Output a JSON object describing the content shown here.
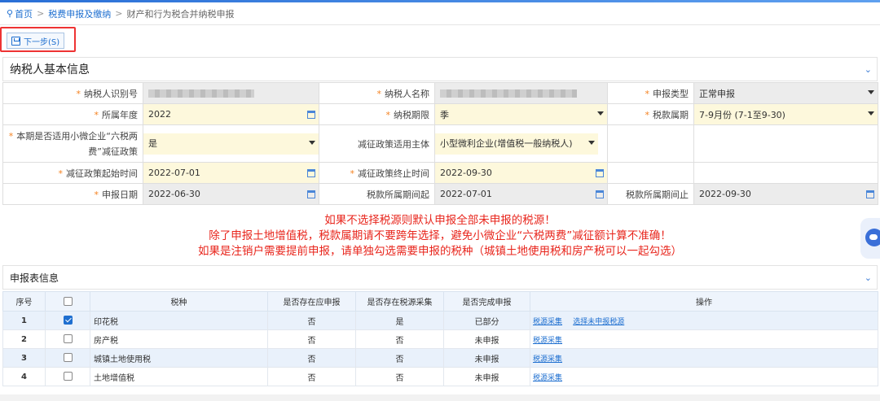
{
  "breadcrumb": {
    "home": "首页",
    "level2": "税费申报及缴纳",
    "current": "财产和行为税合并纳税申报"
  },
  "toolbar": {
    "next_label": "下一步(S)"
  },
  "taxpayer_panel": {
    "title": "纳税人基本信息",
    "fields": {
      "taxpayer_id_label": "纳税人识别号",
      "taxpayer_name_label": "纳税人名称",
      "decl_type_label": "申报类型",
      "decl_type_value": "正常申报",
      "year_label": "所属年度",
      "year_value": "2022",
      "period_label": "纳税期限",
      "period_value": "季",
      "tax_period_label": "税款属期",
      "tax_period_value": "7-9月份 (7-1至9-30)",
      "small_micro_label": "本期是否适用小微企业“六税两费”减征政策",
      "small_micro_value": "是",
      "subject_label": "减征政策适用主体",
      "subject_value": "小型微利企业(增值税一般纳税人)",
      "reduce_start_label": "减征政策起始时间",
      "reduce_start_value": "2022-07-01",
      "reduce_end_label": "减征政策终止时间",
      "reduce_end_value": "2022-09-30",
      "decl_date_label": "申报日期",
      "decl_date_value": "2022-06-30",
      "period_start_label": "税款所属期间起",
      "period_start_value": "2022-07-01",
      "period_end_label": "税款所属期间止",
      "period_end_value": "2022-09-30"
    }
  },
  "warning": {
    "line1": "如果不选择税源则默认申报全部未申报的税源！",
    "line2": "除了申报土地增值税，税款属期请不要跨年选择，避免小微企业“六税两费”减征额计算不准确！",
    "line3": "如果是注销户需要提前申报，请单独勾选需要申报的税种（城镇土地使用税和房产税可以一起勾选）"
  },
  "report_panel": {
    "title": "申报表信息",
    "columns": [
      "序号",
      "",
      "税种",
      "是否存在应申报",
      "是否存在税源采集",
      "是否完成申报",
      "操作"
    ],
    "rows": [
      {
        "no": "1",
        "checked": true,
        "tax": "印花税",
        "should": "否",
        "source": "是",
        "done": "已部分",
        "op1": "税源采集",
        "op2": "选择未申报税源"
      },
      {
        "no": "2",
        "checked": false,
        "tax": "房产税",
        "should": "否",
        "source": "否",
        "done": "未申报",
        "op1": "税源采集",
        "op2": ""
      },
      {
        "no": "3",
        "checked": false,
        "tax": "城镇土地使用税",
        "should": "否",
        "source": "否",
        "done": "未申报",
        "op1": "税源采集",
        "op2": ""
      },
      {
        "no": "4",
        "checked": false,
        "tax": "土地增值税",
        "should": "否",
        "source": "否",
        "done": "未申报",
        "op1": "税源采集",
        "op2": ""
      }
    ]
  },
  "colors": {
    "accent": "#1e6fd0",
    "warning": "#e8251c",
    "required": "#f58220",
    "editable_bg": "#fdf8dc"
  }
}
